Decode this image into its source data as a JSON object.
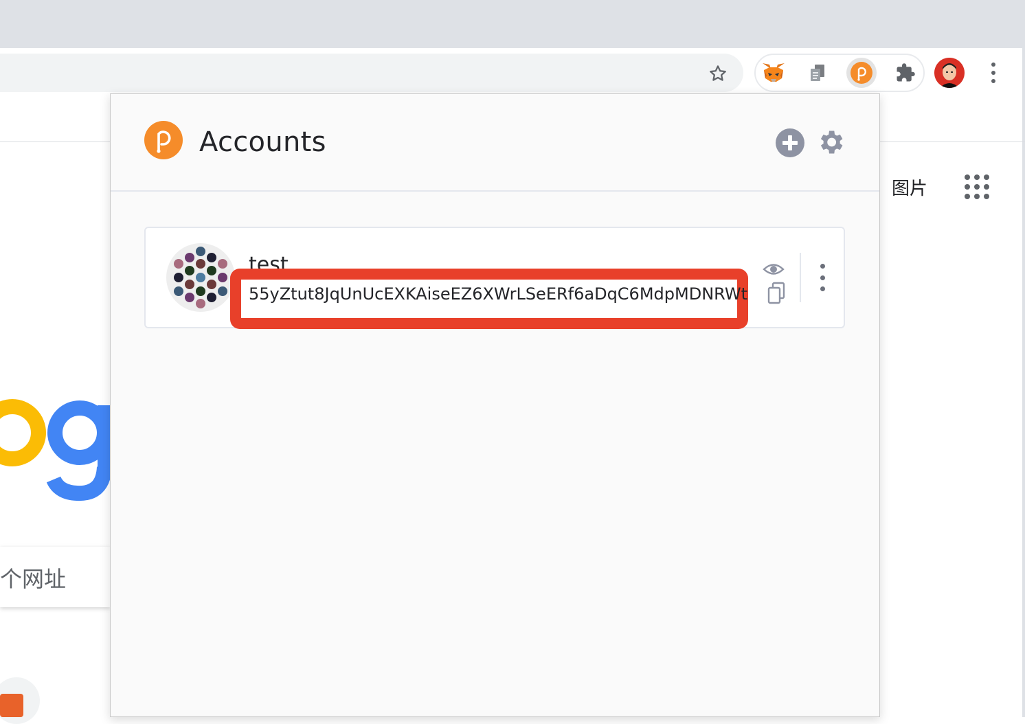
{
  "browser": {
    "extensions": [
      {
        "name": "metamask-icon"
      },
      {
        "name": "copy-extension-icon"
      },
      {
        "name": "polkadot-js-icon",
        "active": true
      },
      {
        "name": "puzzle-icon"
      }
    ],
    "bookmark_icon": "star-icon",
    "profile_icon": "avatar",
    "menu_icon": "kebab-menu-icon"
  },
  "background_page": {
    "images_link": "图片",
    "apps_icon": "apps-grid-icon",
    "search_placeholder_fragment": "个网址"
  },
  "popup": {
    "title": "Accounts",
    "accent_color": "#e6007a",
    "logo_color": "#f58c2a",
    "add_icon": "plus-circle-icon",
    "settings_icon": "gear-icon",
    "account": {
      "name": "test",
      "address": "55yZtut8JqUnUcEXKAiseEZ6XWrLSeERf6aDqC6MdpMDNRWt",
      "highlight_color": "#e8402a",
      "actions": [
        "eye-icon",
        "copy-icon",
        "more-menu-icon"
      ]
    }
  }
}
